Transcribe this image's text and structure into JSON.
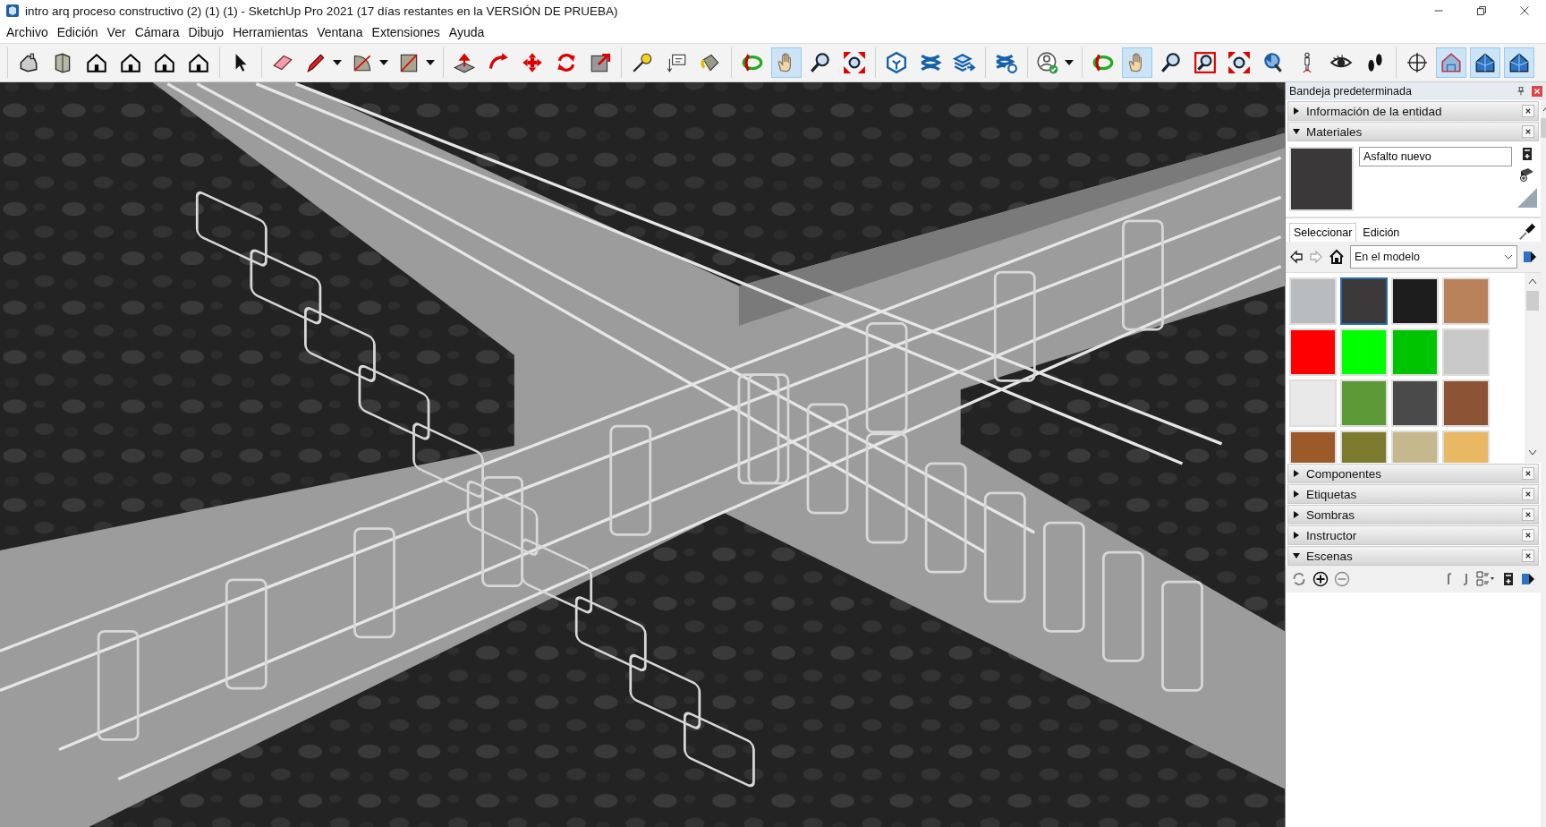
{
  "window": {
    "title": "intro arq proceso constructivo (2) (1) (1) - SketchUp Pro 2021 (17 días restantes en la VERSIÓN DE PRUEBA)"
  },
  "menu": [
    "Archivo",
    "Edición",
    "Ver",
    "Cámara",
    "Dibujo",
    "Herramientas",
    "Ventana",
    "Extensiones",
    "Ayuda"
  ],
  "toolbar": [
    [
      {
        "kind": "iso",
        "selected": false,
        "dropdown": false
      },
      {
        "kind": "box",
        "selected": false,
        "dropdown": false
      },
      {
        "kind": "house",
        "selected": false,
        "dropdown": false
      },
      {
        "kind": "house",
        "selected": false,
        "dropdown": false
      },
      {
        "kind": "house",
        "selected": false,
        "dropdown": false
      },
      {
        "kind": "house",
        "selected": false,
        "dropdown": false
      }
    ],
    [
      {
        "kind": "cursor",
        "selected": false,
        "dropdown": false
      }
    ],
    [
      {
        "kind": "eraser",
        "selected": false,
        "dropdown": false
      },
      {
        "kind": "pencil",
        "selected": false,
        "dropdown": true
      },
      {
        "kind": "arc",
        "selected": false,
        "dropdown": true
      },
      {
        "kind": "rect",
        "selected": false,
        "dropdown": true
      }
    ],
    [
      {
        "kind": "pushpull",
        "selected": false,
        "dropdown": false
      },
      {
        "kind": "followme",
        "selected": false,
        "dropdown": false
      },
      {
        "kind": "move",
        "selected": false,
        "dropdown": false
      },
      {
        "kind": "rotate",
        "selected": false,
        "dropdown": false
      },
      {
        "kind": "scale",
        "selected": false,
        "dropdown": false
      }
    ],
    [
      {
        "kind": "tape",
        "selected": false,
        "dropdown": false
      },
      {
        "kind": "text",
        "selected": false,
        "dropdown": false
      },
      {
        "kind": "paint",
        "selected": false,
        "dropdown": false
      }
    ],
    [
      {
        "kind": "orbit",
        "selected": false,
        "dropdown": false
      },
      {
        "kind": "hand",
        "selected": true,
        "dropdown": false
      },
      {
        "kind": "zoom",
        "selected": false,
        "dropdown": false
      },
      {
        "kind": "zoomext",
        "selected": false,
        "dropdown": false
      }
    ],
    [
      {
        "kind": "warehouse",
        "selected": false,
        "dropdown": false
      },
      {
        "kind": "stack",
        "selected": false,
        "dropdown": false
      },
      {
        "kind": "stackarrow",
        "selected": false,
        "dropdown": false
      }
    ],
    [
      {
        "kind": "stackgear",
        "selected": false,
        "dropdown": false
      }
    ],
    [
      {
        "kind": "user",
        "selected": false,
        "dropdown": true
      }
    ],
    [
      {
        "kind": "orbit",
        "selected": false,
        "dropdown": false
      },
      {
        "kind": "hand",
        "selected": true,
        "dropdown": false
      },
      {
        "kind": "zoom",
        "selected": false,
        "dropdown": false
      },
      {
        "kind": "zoomwin",
        "selected": false,
        "dropdown": false
      },
      {
        "kind": "zoomext",
        "selected": false,
        "dropdown": false
      },
      {
        "kind": "previous",
        "selected": false,
        "dropdown": false
      },
      {
        "kind": "person",
        "selected": false,
        "dropdown": false
      },
      {
        "kind": "eye",
        "selected": false,
        "dropdown": false
      },
      {
        "kind": "feet",
        "selected": false,
        "dropdown": false
      }
    ],
    [
      {
        "kind": "axes",
        "selected": false,
        "dropdown": false
      },
      {
        "kind": "xray",
        "selected": true,
        "dropdown": false
      },
      {
        "kind": "bluehouse",
        "selected": true,
        "dropdown": false
      },
      {
        "kind": "bluehouse",
        "selected": true,
        "dropdown": false
      }
    ]
  ],
  "tray": {
    "title": "Bandeja predeterminada",
    "panels": [
      {
        "title": "Información de la entidad",
        "expanded": false
      },
      {
        "title": "Materiales",
        "expanded": true,
        "kind": "materials"
      },
      {
        "title": "Componentes",
        "expanded": false
      },
      {
        "title": "Etiquetas",
        "expanded": false
      },
      {
        "title": "Sombras",
        "expanded": false
      },
      {
        "title": "Instructor",
        "expanded": false
      },
      {
        "title": "Escenas",
        "expanded": true,
        "kind": "scenes"
      }
    ],
    "materials": {
      "name": "Asfalto nuevo",
      "color": "#3a3839",
      "library": "En el modelo",
      "tabs": [
        {
          "label": "Seleccionar",
          "selected": true
        },
        {
          "label": "Edición",
          "selected": false
        }
      ],
      "swatches": [
        {
          "color": "#b9bcbf",
          "selected": false
        },
        {
          "color": "#3b393a",
          "selected": true
        },
        {
          "color": "#1d1d1d",
          "selected": false
        },
        {
          "color": "#b9825a",
          "selected": false
        },
        {
          "color": "#ff0000",
          "selected": false
        },
        {
          "color": "#00ff00",
          "selected": false
        },
        {
          "color": "#00c400",
          "selected": false
        },
        {
          "color": "#c9c9c9",
          "selected": false
        },
        {
          "color": "#e9e9e9",
          "selected": false
        },
        {
          "color": "#5c9a38",
          "selected": false
        },
        {
          "color": "#4a4a4a",
          "selected": false
        },
        {
          "color": "#8c5434",
          "selected": false
        },
        {
          "color": "#9c5a2a",
          "selected": false
        },
        {
          "color": "#7c7a2c",
          "selected": false
        },
        {
          "color": "#c4b88c",
          "selected": false
        },
        {
          "color": "#e8b862",
          "selected": false
        }
      ]
    }
  }
}
